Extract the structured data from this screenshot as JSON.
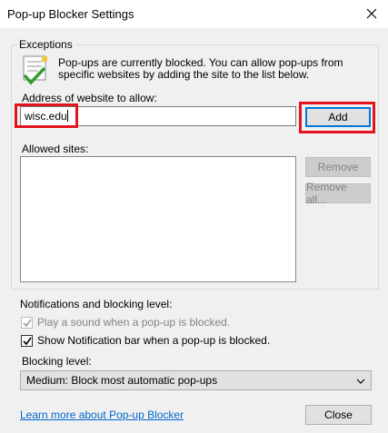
{
  "window": {
    "title": "Pop-up Blocker Settings",
    "close_icon": "close-icon"
  },
  "exceptions": {
    "legend": "Exceptions",
    "info_icon": "info-settings-icon",
    "description": "Pop-ups are currently blocked.  You can allow pop-ups from specific websites by adding the site to the list below.",
    "address_label": "Address of website to allow:",
    "address_value": "wisc.edu",
    "add_button": "Add",
    "allowed_sites_label": "Allowed sites:",
    "allowed_sites": [],
    "remove_button": "Remove",
    "remove_all_button": "Remove all..."
  },
  "notifications": {
    "legend": "Notifications and blocking level:",
    "play_sound_label": "Play a sound when a pop-up is blocked.",
    "play_sound_checked": true,
    "play_sound_enabled": false,
    "show_bar_label": "Show Notification bar when a pop-up is blocked.",
    "show_bar_checked": true,
    "blocking_level_label": "Blocking level:",
    "blocking_level_value": "Medium: Block most automatic pop-ups"
  },
  "footer": {
    "learn_more_link": "Learn more about Pop-up Blocker",
    "close_button": "Close"
  },
  "colors": {
    "highlight": "#e3141b",
    "link": "#0066cc",
    "accent": "#0078d7"
  }
}
